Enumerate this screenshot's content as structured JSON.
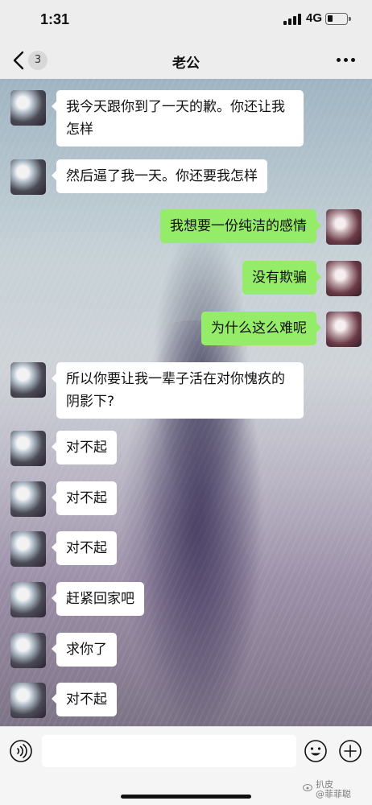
{
  "status": {
    "time": "1:31",
    "network": "4G"
  },
  "nav": {
    "back_badge": "3",
    "title": "老公"
  },
  "messages": [
    {
      "side": "in",
      "text": "我今天跟你到了一天的歉。你还让我怎样"
    },
    {
      "side": "in",
      "text": "然后逼了我一天。你还要我怎样"
    },
    {
      "side": "out",
      "text": "我想要一份纯洁的感情"
    },
    {
      "side": "out",
      "text": "没有欺骗"
    },
    {
      "side": "out",
      "text": "为什么这么难呢"
    },
    {
      "side": "in",
      "text": "所以你要让我一辈子活在对你愧疚的阴影下?"
    },
    {
      "side": "in",
      "text": "对不起"
    },
    {
      "side": "in",
      "text": "对不起"
    },
    {
      "side": "in",
      "text": "对不起"
    },
    {
      "side": "in",
      "text": "赶紧回家吧"
    },
    {
      "side": "in",
      "text": "求你了"
    },
    {
      "side": "in",
      "text": "对不起"
    }
  ],
  "input": {
    "value": "",
    "placeholder": ""
  },
  "icons": [
    "chevron-left-icon",
    "more-icon",
    "voice-icon",
    "emoji-icon",
    "plus-icon"
  ],
  "watermark": {
    "line1": "扒皮",
    "line2": "@菲菲聪"
  },
  "colors": {
    "outgoing_bubble": "#95ec69",
    "incoming_bubble": "#ffffff",
    "bar_bg": "#ededed"
  }
}
